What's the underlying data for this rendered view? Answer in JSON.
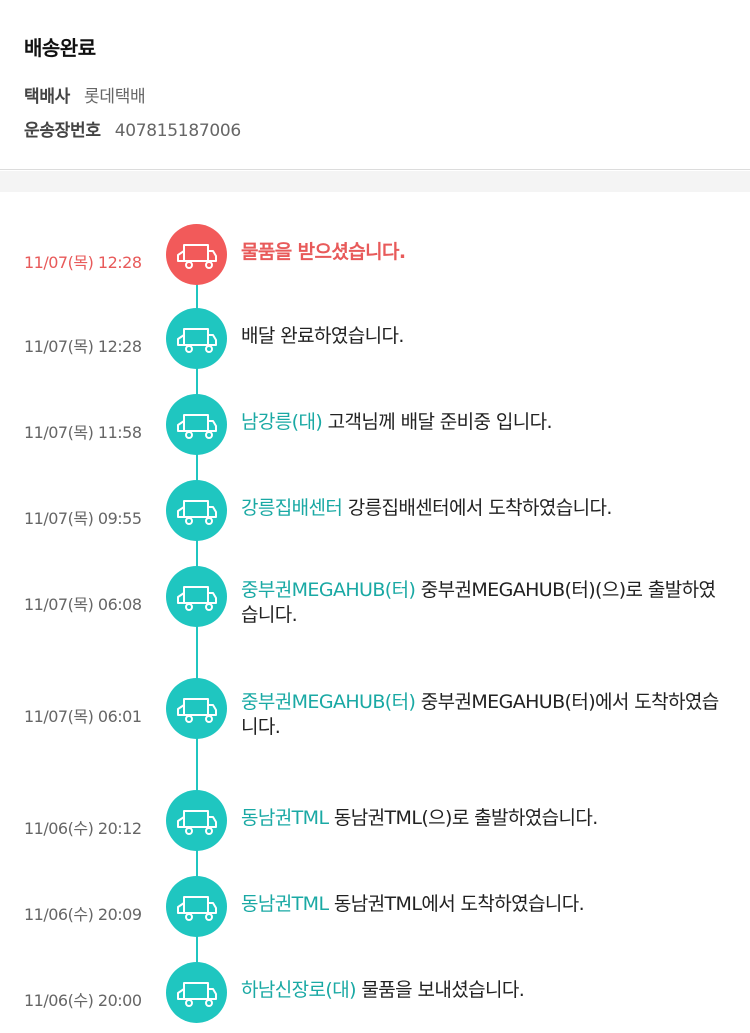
{
  "header": {
    "status_title": "배송완료",
    "carrier_label": "택배사",
    "carrier_value": "롯데택배",
    "tracking_label": "운송장번호",
    "tracking_value": "407815187006"
  },
  "colors": {
    "accent": "#1fc6c0",
    "current": "#f25a5a",
    "location_text": "#1aa9a4"
  },
  "events": [
    {
      "time": "11/07(목) 12:28",
      "location": "",
      "message": "물품을 받으셨습니다.",
      "icon": "truck-icon",
      "current": true
    },
    {
      "time": "11/07(목) 12:28",
      "location": "",
      "message": "배달 완료하였습니다.",
      "icon": "truck-icon"
    },
    {
      "time": "11/07(목) 11:58",
      "location": "남강릉(대)",
      "message": "고객님께 배달 준비중 입니다.",
      "icon": "truck-icon"
    },
    {
      "time": "11/07(목) 09:55",
      "location": "강릉집배센터",
      "message": "강릉집배센터에서 도착하였습니다.",
      "icon": "truck-icon"
    },
    {
      "time": "11/07(목) 06:08",
      "location": "중부권MEGAHUB(터)",
      "message": "중부권MEGAHUB(터)(으)로 출발하였습니다.",
      "icon": "truck-icon"
    },
    {
      "time": "11/07(목) 06:01",
      "location": "중부권MEGAHUB(터)",
      "message": "중부권MEGAHUB(터)에서 도착하였습니다.",
      "icon": "truck-icon"
    },
    {
      "time": "11/06(수) 20:12",
      "location": "동남권TML",
      "message": "동남권TML(으)로 출발하였습니다.",
      "icon": "truck-icon"
    },
    {
      "time": "11/06(수) 20:09",
      "location": "동남권TML",
      "message": "동남권TML에서 도착하였습니다.",
      "icon": "truck-icon"
    },
    {
      "time": "11/06(수) 20:00",
      "location": "하남신장로(대)",
      "message": "물품을 보내셨습니다.",
      "icon": "truck-icon"
    }
  ]
}
